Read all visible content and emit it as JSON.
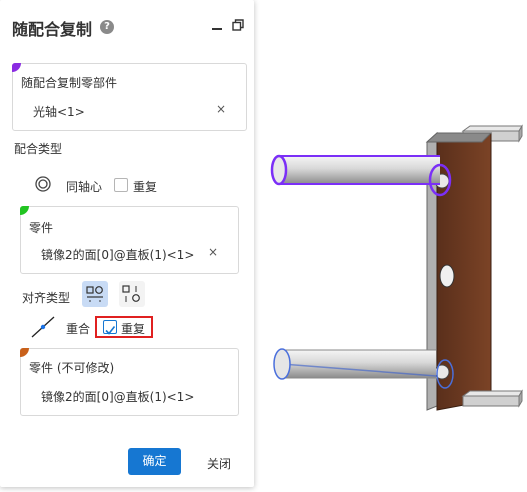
{
  "panel": {
    "title": "随配合复制",
    "help_icon": "?",
    "component_section": {
      "label": "随配合复制零部件",
      "item": "光轴<1>",
      "remove": "×",
      "accent": "#8a2be2"
    },
    "mate_type_label": "配合类型",
    "mate_type": {
      "concentric_label": "同轴心",
      "repeat_label": "重复",
      "repeat_checked": false
    },
    "part_section": {
      "label": "零件",
      "item": "镜像2的面[0]@直板(1)<1>",
      "remove": "×",
      "accent": "#22c422"
    },
    "alignment_label": "对齐类型",
    "coincident": {
      "label": "重合",
      "repeat_label": "重复",
      "repeat_checked": true
    },
    "fixed_part_section": {
      "label": "零件 (不可修改)",
      "item": "镜像2的面[0]@直板(1)<1>",
      "accent": "#c8601a"
    },
    "ok_label": "确定",
    "close_label": "关闭"
  },
  "colors": {
    "primary": "#1677d2",
    "highlight": "#e02020",
    "plate": "#6b3a22",
    "selection": "#7b2ff7"
  }
}
